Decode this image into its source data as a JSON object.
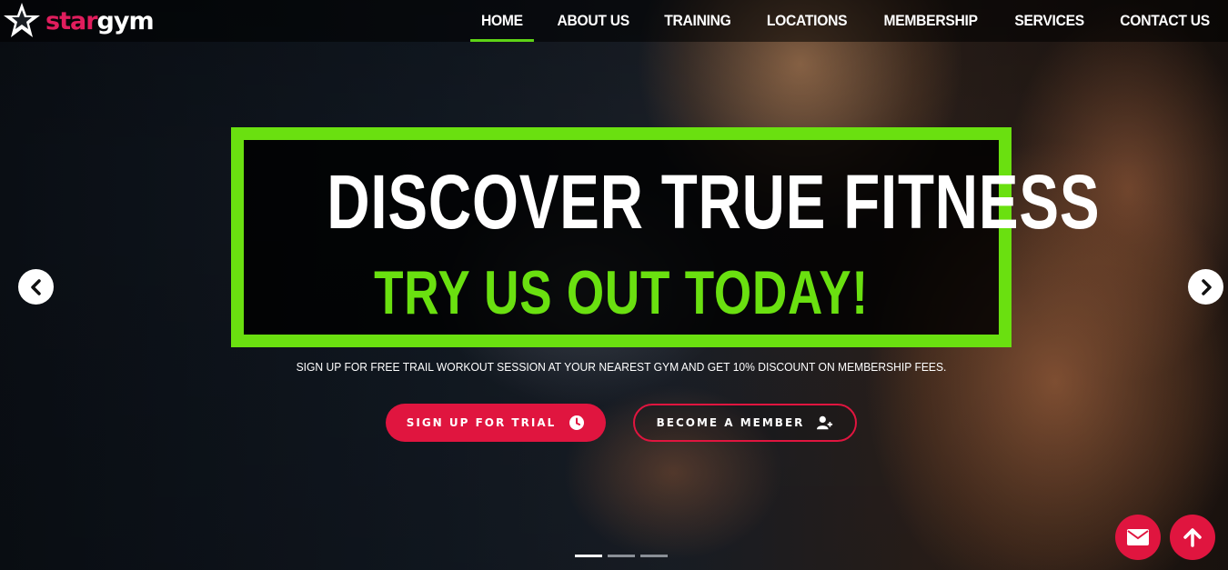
{
  "brand": {
    "logo_part1": "star",
    "logo_part2": "gym",
    "accent_color": "#e01d5d"
  },
  "nav": {
    "items": [
      {
        "label": "HOME",
        "active": true
      },
      {
        "label": "ABOUT US",
        "active": false
      },
      {
        "label": "TRAINING",
        "active": false
      },
      {
        "label": "LOCATIONS",
        "active": false
      },
      {
        "label": "MEMBERSHIP",
        "active": false
      },
      {
        "label": "SERVICES",
        "active": false
      },
      {
        "label": "CONTACT US",
        "active": false
      }
    ],
    "active_indicator_color": "#5ed316"
  },
  "hero": {
    "headline": "DISCOVER TRUE FITNESS",
    "subheadline": "TRY US OUT TODAY!",
    "tagline": "SIGN UP FOR FREE TRAIL WORKOUT SESSION AT YOUR NEAREST GYM AND GET 10% DISCOUNT ON MEMBERSHIP FEES.",
    "frame_color": "#6ae010",
    "buttons": {
      "trial_label": "SIGN UP FOR TRIAL",
      "trial_icon": "clock-icon",
      "member_label": "BECOME A MEMBER",
      "member_icon": "user-plus-icon"
    }
  },
  "carousel": {
    "prev_icon": "chevron-left-icon",
    "next_icon": "chevron-right-icon",
    "slide_count": 3,
    "active_slide": 1
  },
  "floating_actions": {
    "mail_icon": "envelope-icon",
    "top_icon": "arrow-up-icon",
    "color": "#e0153f"
  }
}
